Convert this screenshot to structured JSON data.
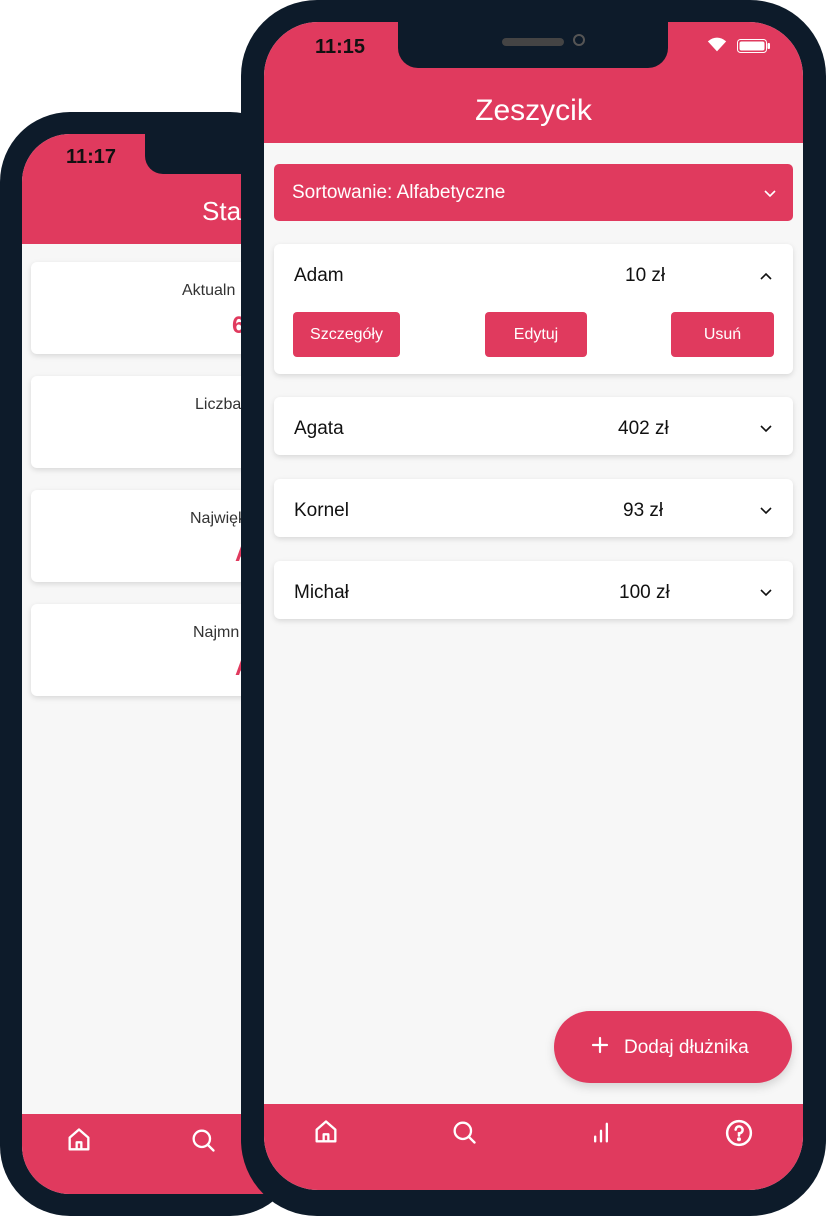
{
  "back_phone": {
    "status_time": "11:17",
    "title_partial": "Sta",
    "stats": [
      {
        "label": "Aktualn",
        "value": "6"
      },
      {
        "label": "Liczba",
        "value": ""
      },
      {
        "label": "Największ",
        "value": "A"
      },
      {
        "label": "Najmn",
        "value": "A"
      }
    ],
    "nav_icons": [
      "home-icon",
      "search-icon"
    ]
  },
  "front_phone": {
    "status_time": "11:15",
    "title": "Zeszycik",
    "sort_label": "Sortowanie: Alfabetyczne",
    "debtors": [
      {
        "name": "Adam",
        "amount": "10 zł",
        "expanded": true
      },
      {
        "name": "Agata",
        "amount": "402 zł",
        "expanded": false
      },
      {
        "name": "Kornel",
        "amount": "93 zł",
        "expanded": false
      },
      {
        "name": "Michał",
        "amount": "100 zł",
        "expanded": false
      }
    ],
    "actions": {
      "details": "Szczegóły",
      "edit": "Edytuj",
      "delete": "Usuń"
    },
    "fab_label": "Dodaj dłużnika",
    "nav_icons": [
      "home-icon",
      "search-icon",
      "stats-icon",
      "help-icon"
    ]
  },
  "colors": {
    "accent": "#e03a5e",
    "frame": "#0d1b2a",
    "background": "#f7f7f7"
  }
}
